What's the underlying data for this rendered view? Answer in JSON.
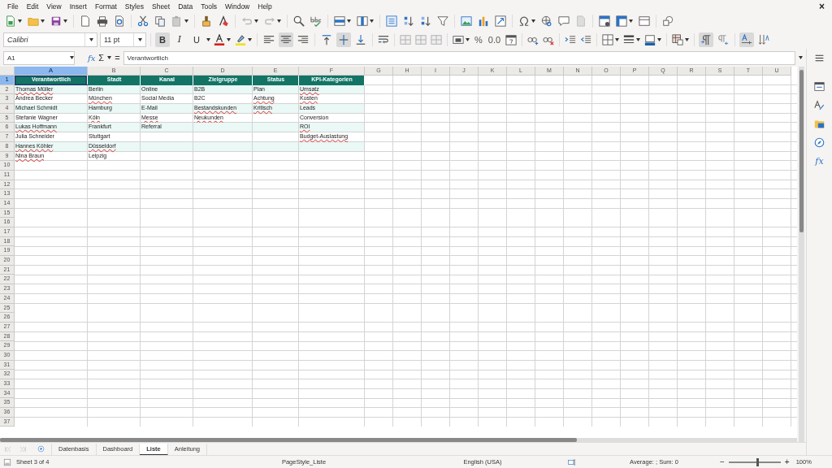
{
  "window": {
    "close": "×"
  },
  "menu": [
    "File",
    "Edit",
    "View",
    "Insert",
    "Format",
    "Styles",
    "Sheet",
    "Data",
    "Tools",
    "Window",
    "Help"
  ],
  "toolbar_format": {
    "font_name": "Calibri",
    "font_size": "11 pt",
    "bold": {
      "label": "B",
      "on": true
    },
    "italic": {
      "label": "I",
      "on": false
    },
    "underline": {
      "label": "U",
      "on": false
    },
    "align_left": false,
    "align_center": true,
    "align_right": false,
    "valign_top": false,
    "valign_center": true,
    "valign_bottom": false,
    "percent": "%",
    "decimal": "0.0",
    "para_ltr": true,
    "para_rtl": false,
    "text_horizontal": true,
    "text_vertical": false
  },
  "formula_bar": {
    "name_box": "A1",
    "function_wizard": "fx",
    "sum": "Σ",
    "equals": "=",
    "content": "Verantwortlich"
  },
  "columns": [
    {
      "label": "A",
      "selected": true
    },
    {
      "label": "B",
      "selected": false
    },
    {
      "label": "C",
      "selected": false
    },
    {
      "label": "D",
      "selected": false
    },
    {
      "label": "E",
      "selected": false
    },
    {
      "label": "F",
      "selected": false
    },
    {
      "label": "G",
      "selected": false
    },
    {
      "label": "H",
      "selected": false
    },
    {
      "label": "I",
      "selected": false
    },
    {
      "label": "J",
      "selected": false
    },
    {
      "label": "K",
      "selected": false
    },
    {
      "label": "L",
      "selected": false
    },
    {
      "label": "M",
      "selected": false
    },
    {
      "label": "N",
      "selected": false
    },
    {
      "label": "O",
      "selected": false
    },
    {
      "label": "P",
      "selected": false
    },
    {
      "label": "Q",
      "selected": false
    },
    {
      "label": "R",
      "selected": false
    },
    {
      "label": "S",
      "selected": false
    },
    {
      "label": "T",
      "selected": false
    },
    {
      "label": "U",
      "selected": false
    }
  ],
  "rows": [
    {
      "number": "1",
      "selected": true,
      "kind": "header",
      "cells": [
        {
          "text": "Verantwortlich",
          "misspelled": false
        },
        {
          "text": "Stadt",
          "misspelled": false
        },
        {
          "text": "Kanal",
          "misspelled": false
        },
        {
          "text": "Zielgruppe",
          "misspelled": false
        },
        {
          "text": "Status",
          "misspelled": false
        },
        {
          "text": "KPI-Kategorien",
          "misspelled": false
        }
      ]
    },
    {
      "number": "2",
      "selected": false,
      "kind": "data",
      "cells": [
        {
          "text": "Thomas Müller",
          "misspelled": true
        },
        {
          "text": "Berlin",
          "misspelled": false
        },
        {
          "text": "Online",
          "misspelled": false
        },
        {
          "text": "B2B",
          "misspelled": false
        },
        {
          "text": "Plan",
          "misspelled": false
        },
        {
          "text": "Umsatz",
          "misspelled": true
        }
      ]
    },
    {
      "number": "3",
      "selected": false,
      "kind": "data",
      "cells": [
        {
          "text": "Andrea Becker",
          "misspelled": false
        },
        {
          "text": "München",
          "misspelled": true
        },
        {
          "text": "Social Media",
          "misspelled": false
        },
        {
          "text": "B2C",
          "misspelled": false
        },
        {
          "text": "Achtung",
          "misspelled": true
        },
        {
          "text": "Kosten",
          "misspelled": true
        }
      ]
    },
    {
      "number": "4",
      "selected": false,
      "kind": "data",
      "cells": [
        {
          "text": "Michael Schmidt",
          "misspelled": false
        },
        {
          "text": "Hamburg",
          "misspelled": false
        },
        {
          "text": "E-Mail",
          "misspelled": false
        },
        {
          "text": "Bestandskunden",
          "misspelled": true
        },
        {
          "text": "Kritisch",
          "misspelled": true
        },
        {
          "text": "Leads",
          "misspelled": false
        }
      ]
    },
    {
      "number": "5",
      "selected": false,
      "kind": "data",
      "cells": [
        {
          "text": "Stefanie Wagner",
          "misspelled": false
        },
        {
          "text": "Köln",
          "misspelled": true
        },
        {
          "text": "Messe",
          "misspelled": true
        },
        {
          "text": "Neukunden",
          "misspelled": true
        },
        null,
        {
          "text": "Conversion",
          "misspelled": false
        }
      ]
    },
    {
      "number": "6",
      "selected": false,
      "kind": "data",
      "cells": [
        {
          "text": "Lukas Hoffmann",
          "misspelled": true
        },
        {
          "text": "Frankfurt",
          "misspelled": false
        },
        {
          "text": "Referral",
          "misspelled": false
        },
        null,
        null,
        {
          "text": "ROI",
          "misspelled": true
        }
      ]
    },
    {
      "number": "7",
      "selected": false,
      "kind": "data",
      "cells": [
        {
          "text": "Julia Schneider",
          "misspelled": false
        },
        {
          "text": "Stuttgart",
          "misspelled": false
        },
        null,
        null,
        null,
        {
          "text": "Budget-Auslastung",
          "misspelled": true
        }
      ]
    },
    {
      "number": "8",
      "selected": false,
      "kind": "data",
      "cells": [
        {
          "text": "Hannes Köhler",
          "misspelled": true
        },
        {
          "text": "Düsseldorf",
          "misspelled": true
        }
      ]
    },
    {
      "number": "9",
      "selected": false,
      "kind": "data",
      "cells": [
        {
          "text": "Nina Braun",
          "misspelled": true
        },
        {
          "text": "Leipzig",
          "misspelled": false
        }
      ]
    },
    {
      "number": "10",
      "selected": false,
      "kind": "empty"
    },
    {
      "number": "11",
      "selected": false,
      "kind": "empty"
    },
    {
      "number": "12",
      "selected": false,
      "kind": "empty"
    },
    {
      "number": "13",
      "selected": false,
      "kind": "empty"
    },
    {
      "number": "14",
      "selected": false,
      "kind": "empty"
    },
    {
      "number": "15",
      "selected": false,
      "kind": "empty"
    },
    {
      "number": "16",
      "selected": false,
      "kind": "empty"
    },
    {
      "number": "17",
      "selected": false,
      "kind": "empty"
    },
    {
      "number": "18",
      "selected": false,
      "kind": "empty"
    },
    {
      "number": "19",
      "selected": false,
      "kind": "empty"
    },
    {
      "number": "20",
      "selected": false,
      "kind": "empty"
    },
    {
      "number": "21",
      "selected": false,
      "kind": "empty"
    },
    {
      "number": "22",
      "selected": false,
      "kind": "empty"
    },
    {
      "number": "23",
      "selected": false,
      "kind": "empty"
    },
    {
      "number": "24",
      "selected": false,
      "kind": "empty"
    },
    {
      "number": "25",
      "selected": false,
      "kind": "empty"
    },
    {
      "number": "26",
      "selected": false,
      "kind": "empty"
    },
    {
      "number": "27",
      "selected": false,
      "kind": "empty"
    },
    {
      "number": "28",
      "selected": false,
      "kind": "empty"
    },
    {
      "number": "29",
      "selected": false,
      "kind": "empty"
    },
    {
      "number": "30",
      "selected": false,
      "kind": "empty"
    },
    {
      "number": "31",
      "selected": false,
      "kind": "empty"
    },
    {
      "number": "32",
      "selected": false,
      "kind": "empty"
    },
    {
      "number": "33",
      "selected": false,
      "kind": "empty"
    },
    {
      "number": "34",
      "selected": false,
      "kind": "empty"
    },
    {
      "number": "35",
      "selected": false,
      "kind": "empty"
    },
    {
      "number": "36",
      "selected": false,
      "kind": "empty"
    },
    {
      "number": "37",
      "selected": false,
      "kind": "empty"
    }
  ],
  "sheet_tabs": [
    {
      "label": "Datenbasis",
      "selected": false
    },
    {
      "label": "Dashboard",
      "selected": false
    },
    {
      "label": "Liste",
      "selected": true
    },
    {
      "label": "Anleitung",
      "selected": false
    }
  ],
  "sidebar": {
    "functions_glyph": "fx"
  },
  "status_bar": {
    "sheet": "Sheet 3 of 4",
    "page_style": "PageStyle_Liste",
    "language": "English (USA)",
    "summary": "Average: ; Sum: 0",
    "zoom_out": "−",
    "zoom_in": "+",
    "zoom": {
      "level": 0.55,
      "reading": "100%"
    }
  }
}
